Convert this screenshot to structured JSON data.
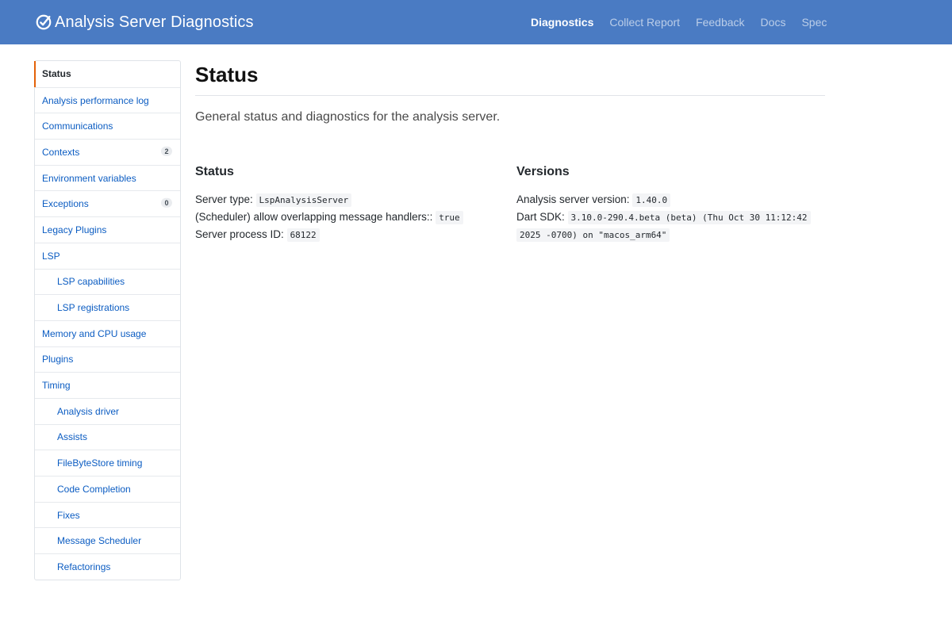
{
  "header": {
    "title": "Analysis Server Diagnostics",
    "logo_icon": "gauge-check-icon",
    "nav": [
      {
        "label": "Diagnostics",
        "active": true
      },
      {
        "label": "Collect Report",
        "active": false
      },
      {
        "label": "Feedback",
        "active": false
      },
      {
        "label": "Docs",
        "active": false
      },
      {
        "label": "Spec",
        "active": false
      }
    ]
  },
  "sidebar": {
    "items": [
      {
        "label": "Status",
        "selected": true,
        "sub": false,
        "count": null
      },
      {
        "label": "Analysis performance log",
        "sub": false,
        "count": null
      },
      {
        "label": "Communications",
        "sub": false,
        "count": null
      },
      {
        "label": "Contexts",
        "sub": false,
        "count": "2"
      },
      {
        "label": "Environment variables",
        "sub": false,
        "count": null
      },
      {
        "label": "Exceptions",
        "sub": false,
        "count": "0"
      },
      {
        "label": "Legacy Plugins",
        "sub": false,
        "count": null
      },
      {
        "label": "LSP",
        "sub": false,
        "count": null
      },
      {
        "label": "LSP capabilities",
        "sub": true,
        "count": null
      },
      {
        "label": "LSP registrations",
        "sub": true,
        "count": null
      },
      {
        "label": "Memory and CPU usage",
        "sub": false,
        "count": null
      },
      {
        "label": "Plugins",
        "sub": false,
        "count": null
      },
      {
        "label": "Timing",
        "sub": false,
        "count": null
      },
      {
        "label": "Analysis driver",
        "sub": true,
        "count": null
      },
      {
        "label": "Assists",
        "sub": true,
        "count": null
      },
      {
        "label": "FileByteStore timing",
        "sub": true,
        "count": null
      },
      {
        "label": "Code Completion",
        "sub": true,
        "count": null
      },
      {
        "label": "Fixes",
        "sub": true,
        "count": null
      },
      {
        "label": "Message Scheduler",
        "sub": true,
        "count": null
      },
      {
        "label": "Refactorings",
        "sub": true,
        "count": null
      }
    ]
  },
  "main": {
    "title": "Status",
    "lead": "General status and diagnostics for the analysis server.",
    "status": {
      "heading": "Status",
      "server_type_label": "Server type:",
      "server_type_value": "LspAnalysisServer",
      "overlap_label": "(Scheduler) allow overlapping message handlers::",
      "overlap_value": "true",
      "pid_label": "Server process ID:",
      "pid_value": "68122"
    },
    "versions": {
      "heading": "Versions",
      "server_version_label": "Analysis server version:",
      "server_version_value": "1.40.0",
      "sdk_label": "Dart SDK:",
      "sdk_value": "3.10.0-290.4.beta (beta) (Thu Oct 30 11:12:42 2025 -0700) on \"macos_arm64\""
    }
  },
  "colors": {
    "header_bg": "#4a7bc3",
    "link": "#0b5cc2",
    "selected_marker": "#e36209"
  }
}
